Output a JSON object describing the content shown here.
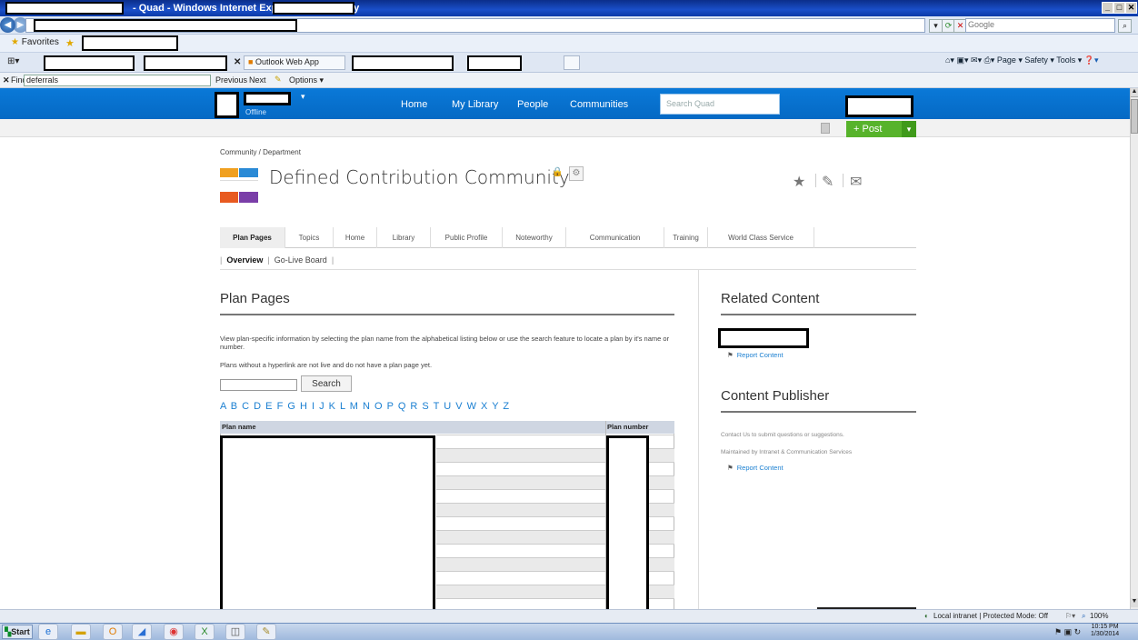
{
  "browser": {
    "title_suffix": "- Quad - Windows Internet Explorer provided by",
    "search_placeholder": "Google",
    "favorites_label": "Favorites",
    "tabs": [
      {
        "label": "Outlook Web App"
      }
    ],
    "command_bar": "Page ▾  Safety ▾  Tools ▾",
    "find_label": "Find:",
    "find_value": "deferrals",
    "find_previous": "Previous",
    "find_next": "Next",
    "find_options": "Options ▾"
  },
  "site": {
    "nav": [
      "Home",
      "My Library",
      "People",
      "Communities"
    ],
    "search_placeholder": "Search Quad",
    "status": "Offline",
    "post_label": "+ Post"
  },
  "community": {
    "breadcrumb": "Community / Department",
    "title": "Defined Contribution Community",
    "tabs": [
      "Plan Pages",
      "Topics",
      "Home",
      "Library",
      "Public Profile",
      "Noteworthy",
      "Communication",
      "Training",
      "World Class Service"
    ],
    "subnav_active": "Overview",
    "subnav_other": "Go-Live Board"
  },
  "plan_pages": {
    "heading": "Plan Pages",
    "intro": "View plan-specific information by selecting the plan name from the alphabetical listing below or use the search feature to locate a plan by it's name or number.",
    "note": "Plans without a hyperlink are not live and do not have a plan page yet.",
    "search_button": "Search",
    "alphabet": "A B C D E F G H I J K L M N O P Q R S T U V W X Y Z",
    "col_name": "Plan name",
    "col_number": "Plan number"
  },
  "sidebar": {
    "related_heading": "Related Content",
    "report_link": "Report Content",
    "publisher_heading": "Content Publisher",
    "contact_text": "Contact Us to submit questions or suggestions.",
    "maintained_text": "Maintained by Intranet & Communication Services"
  },
  "statusbar": {
    "zone": "Local intranet | Protected Mode: Off",
    "zoom": "100%"
  },
  "taskbar": {
    "start_label": "Start",
    "time": "10:15 PM",
    "date": "1/30/2014"
  }
}
